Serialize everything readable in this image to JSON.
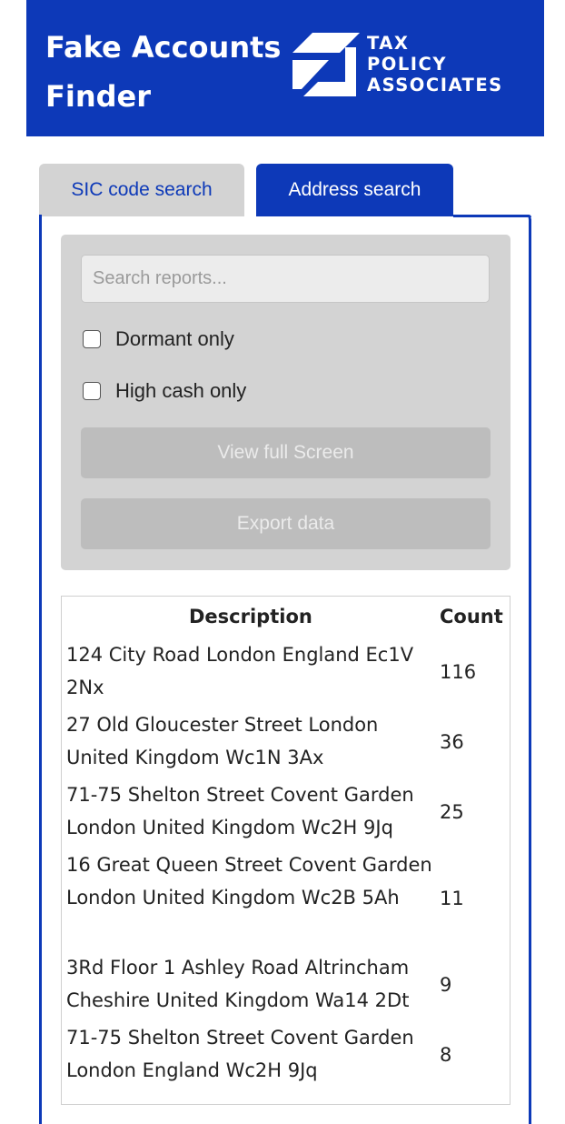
{
  "header": {
    "title": "Fake Accounts Finder",
    "logo": {
      "line1": "TAX",
      "line2": "POLICY",
      "line3": "ASSOCIATES"
    }
  },
  "tabs": [
    {
      "label": "SIC code search",
      "active": false
    },
    {
      "label": "Address search",
      "active": true
    }
  ],
  "filters": {
    "search_placeholder": "Search reports...",
    "search_value": "",
    "dormant_label": "Dormant only",
    "dormant_checked": false,
    "high_cash_label": "High cash only",
    "high_cash_checked": false,
    "view_full_screen_label": "View full Screen",
    "export_label": "Export data"
  },
  "table": {
    "columns": [
      "Description",
      "Count"
    ],
    "rows": [
      {
        "description": "124 City Road London England Ec1V 2Nx",
        "count": "116"
      },
      {
        "description": "27 Old Gloucester Street London United Kingdom Wc1N 3Ax",
        "count": "36"
      },
      {
        "description": "71-75 Shelton Street Covent Garden London United Kingdom Wc2H 9Jq",
        "count": "25"
      },
      {
        "description": "16 Great Queen Street Covent Garden London United Kingdom Wc2B 5Ah",
        "count": "11"
      },
      {
        "description": "3Rd Floor 1 Ashley Road Altrincham Cheshire United Kingdom Wa14 2Dt",
        "count": "9"
      },
      {
        "description": "71-75 Shelton Street Covent Garden London England Wc2H 9Jq",
        "count": "8"
      }
    ]
  },
  "colors": {
    "brand_blue": "#0d39b8",
    "panel_gray": "#d3d3d3",
    "disabled_button": "#bdbdbd"
  }
}
